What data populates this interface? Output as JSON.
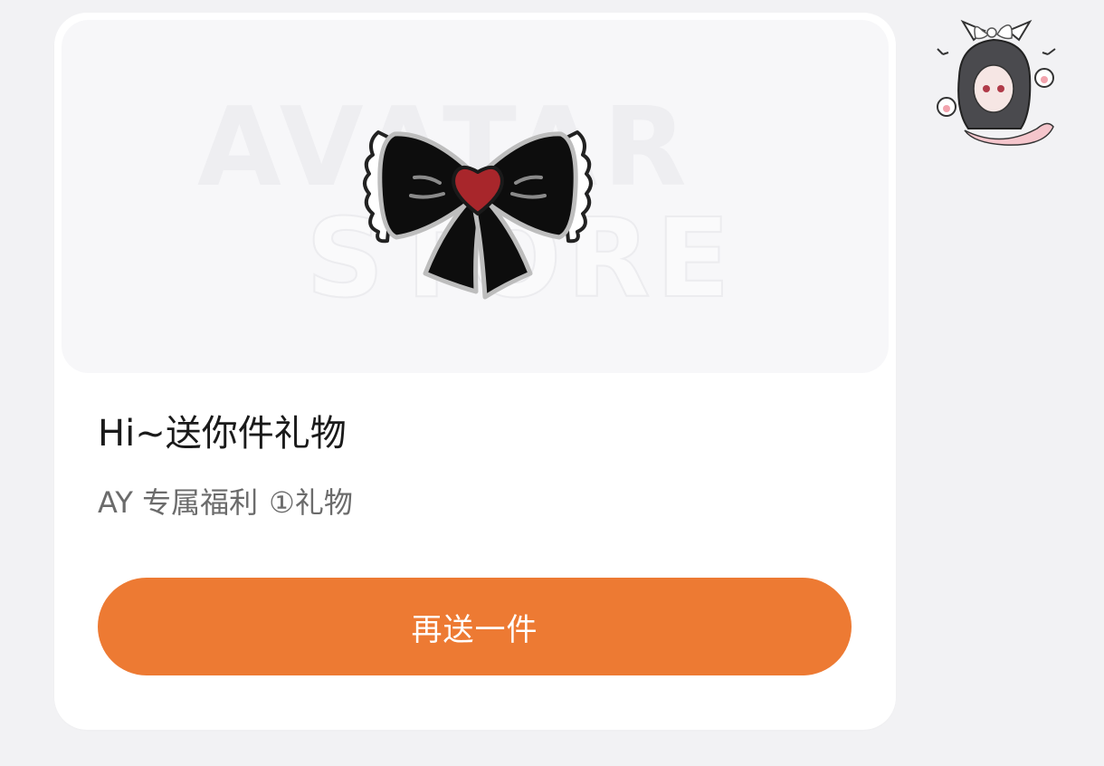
{
  "card": {
    "watermark_line1": "AVATAR",
    "watermark_line2": "STORE",
    "title": "Hi~送你件礼物",
    "subtitle_tag": "AY 专属福利",
    "subtitle_count": "①礼物",
    "button_label": "再送一件"
  },
  "icons": {
    "gift": "bow-icon",
    "avatar": "avatar-image"
  },
  "colors": {
    "accent": "#ed7a33",
    "background": "#f2f2f4"
  }
}
